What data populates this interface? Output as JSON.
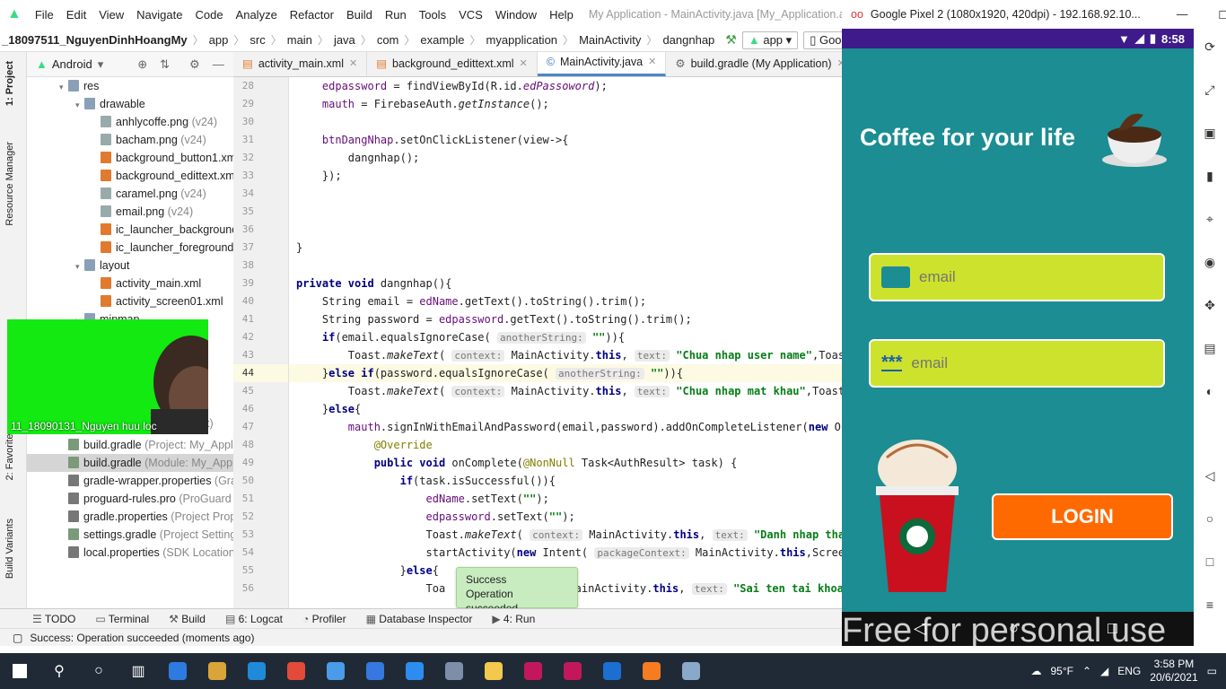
{
  "ide": {
    "menu": [
      "File",
      "Edit",
      "View",
      "Navigate",
      "Code",
      "Analyze",
      "Refactor",
      "Build",
      "Run",
      "Tools",
      "VCS",
      "Window",
      "Help"
    ],
    "window_title": "My Application - MainActivity.java [My_Application.app] - An",
    "breadcrumb": [
      "_18097511_NguyenDinhHoangMy",
      "app",
      "src",
      "main",
      "java",
      "com",
      "example",
      "myapplication",
      "MainActivity",
      "dangnhap"
    ],
    "run_config": "app",
    "device": "Google",
    "project_view": "Android",
    "left_tabs": [
      "1: Project",
      "Resource Manager",
      "2: Favorites",
      "Build Variants"
    ],
    "tree": [
      {
        "indent": 1,
        "twisty": "▾",
        "label": "res",
        "color": "#8aa0b8"
      },
      {
        "indent": 2,
        "twisty": "▾",
        "label": "drawable",
        "color": "#8aa0b8"
      },
      {
        "indent": 3,
        "twisty": "",
        "label": "anhlycoffe.png",
        "sec": " (v24)",
        "color": "#9aa"
      },
      {
        "indent": 3,
        "twisty": "",
        "label": "bacham.png",
        "sec": " (v24)",
        "color": "#9aa"
      },
      {
        "indent": 3,
        "twisty": "",
        "label": "background_button1.xml",
        "sec": "",
        "color": "#e07a2e"
      },
      {
        "indent": 3,
        "twisty": "",
        "label": "background_edittext.xml",
        "sec": "",
        "color": "#e07a2e"
      },
      {
        "indent": 3,
        "twisty": "",
        "label": "caramel.png",
        "sec": " (v24)",
        "color": "#9aa"
      },
      {
        "indent": 3,
        "twisty": "",
        "label": "email.png",
        "sec": " (v24)",
        "color": "#9aa"
      },
      {
        "indent": 3,
        "twisty": "",
        "label": "ic_launcher_background.x",
        "sec": "",
        "color": "#e07a2e"
      },
      {
        "indent": 3,
        "twisty": "",
        "label": "ic_launcher_foreground.xı",
        "sec": "",
        "color": "#e07a2e"
      },
      {
        "indent": 2,
        "twisty": "▾",
        "label": "layout",
        "color": "#8aa0b8"
      },
      {
        "indent": 3,
        "twisty": "",
        "label": "activity_main.xml",
        "sec": "",
        "color": "#e07a2e"
      },
      {
        "indent": 3,
        "twisty": "",
        "label": "activity_screen01.xml",
        "sec": "",
        "color": "#e07a2e"
      },
      {
        "indent": 2,
        "twisty": "▸",
        "label": "mipmap",
        "color": "#8aa0b8"
      },
      {
        "indent": 2,
        "twisty": "",
        "label": "",
        "sec": "",
        "color": "transparent"
      },
      {
        "indent": 2,
        "twisty": "",
        "label": "",
        "sec": "",
        "color": "transparent"
      },
      {
        "indent": 2,
        "twisty": "",
        "label": "",
        "sec": "",
        "color": "transparent"
      },
      {
        "indent": 2,
        "twisty": "",
        "label": "",
        "sec": "",
        "color": "transparent"
      },
      {
        "indent": 1,
        "twisty": "▸",
        "label": "res",
        "sec": " (generated)",
        "color": "#8aa0b8"
      },
      {
        "indent": 0,
        "twisty": "▾",
        "label": "Gradle Scripts",
        "sec": "",
        "color": "#7a9a7a"
      },
      {
        "indent": 1,
        "twisty": "",
        "label": "build.gradle",
        "sec": " (Project: My_Applica",
        "color": "#7a9a7a"
      },
      {
        "indent": 1,
        "twisty": "",
        "label": "build.gradle",
        "sec": " (Module: My_Applic",
        "color": "#7a9a7a",
        "selected": true
      },
      {
        "indent": 1,
        "twisty": "",
        "label": "gradle-wrapper.properties",
        "sec": " (Gradl",
        "color": "#777"
      },
      {
        "indent": 1,
        "twisty": "",
        "label": "proguard-rules.pro",
        "sec": " (ProGuard Ru",
        "color": "#777"
      },
      {
        "indent": 1,
        "twisty": "",
        "label": "gradle.properties",
        "sec": " (Project Propert",
        "color": "#777"
      },
      {
        "indent": 1,
        "twisty": "",
        "label": "settings.gradle",
        "sec": " (Project Settings)",
        "color": "#7a9a7a"
      },
      {
        "indent": 1,
        "twisty": "",
        "label": "local.properties",
        "sec": " (SDK Location)",
        "color": "#777"
      }
    ],
    "tree_partial_label": "t)",
    "webcam_label": "11_18090131_Nguyen huu loc",
    "tabs": [
      {
        "label": "activity_main.xml",
        "active": false
      },
      {
        "label": "background_edittext.xml",
        "active": false
      },
      {
        "label": "MainActivity.java",
        "active": true
      },
      {
        "label": "build.gradle (My Application)",
        "active": false
      }
    ],
    "line_numbers": [
      "28",
      "29",
      "30",
      "31",
      "32",
      "33",
      "34",
      "35",
      "36",
      "37",
      "38",
      "39",
      "40",
      "41",
      "42",
      "43",
      "44",
      "45",
      "46",
      "47",
      "48",
      "49",
      "50",
      "51",
      "52",
      "53",
      "54",
      "55",
      "56"
    ],
    "current_line": "44",
    "toast": {
      "title": "Success",
      "message": "Operation succeeded"
    },
    "bottom_tabs": [
      "TODO",
      "Terminal",
      "Build",
      "6: Logcat",
      "Profiler",
      "Database Inspector",
      "4: Run"
    ],
    "status": "Success: Operation succeeded (moments ago)"
  },
  "emulator": {
    "title": "Google Pixel 2 (1080x1920, 420dpi) - 192.168.92.10...",
    "time": "8:58",
    "app_title": "Coffee for your life",
    "email_placeholder": "email",
    "password_placeholder": "email",
    "password_icon_text": "***",
    "login_label": "LOGIN",
    "watermark": "Free for personal use"
  },
  "taskbar": {
    "weather": "95°F",
    "lang": "ENG",
    "time": "3:58 PM",
    "date": "20/6/2021",
    "app_colors": [
      "#2d7be0",
      "#d9a43a",
      "#1f8ad8",
      "#e24a3a",
      "#4a9be8",
      "#3678e0",
      "#2d8cf0",
      "#7c8ea8",
      "#f2c94c",
      "#c2185b",
      "#c2185b",
      "#1b6fd1",
      "#f57c20",
      "#8aa8c8"
    ]
  }
}
